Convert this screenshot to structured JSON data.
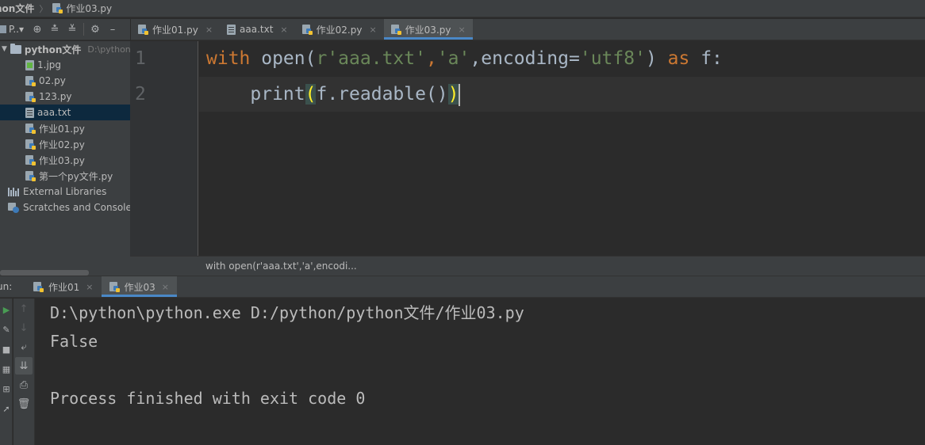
{
  "breadcrumb": {
    "project": "hon文件",
    "file": "作业03.py"
  },
  "project_panel": {
    "dropdown_label": "P..▾",
    "root": {
      "name": "python文件",
      "path": "D:\\python\\"
    },
    "files": [
      "1.jpg",
      "02.py",
      "123.py",
      "aaa.txt",
      "作业01.py",
      "作业02.py",
      "作业03.py",
      "第一个py文件.py"
    ],
    "selected_file": "aaa.txt",
    "external_libraries": "External Libraries",
    "scratches": "Scratches and Consoles"
  },
  "editor_tabs": [
    {
      "label": "作业01.py",
      "close": "×"
    },
    {
      "label": "aaa.txt",
      "close": "×"
    },
    {
      "label": "作业02.py",
      "close": "×"
    },
    {
      "label": "作业03.py",
      "close": "×"
    }
  ],
  "active_tab": "作业03.py",
  "editor": {
    "line_numbers": [
      "1",
      "2"
    ],
    "line1": {
      "kw_with": "with",
      "open": " open(",
      "s1": "r'aaa.txt'",
      "comma1": ",",
      "s2": "'a'",
      "enc": ",encoding=",
      "s3": "'utf8'",
      "close": ") ",
      "kw_as": "as",
      "f": " f:"
    },
    "line2": {
      "indent": "    print",
      "lparen": "(",
      "body": "f.readable()",
      "rparen": ")"
    }
  },
  "structure_breadcrumb": "with open(r'aaa.txt','a',encodi...",
  "run_panel": {
    "label": "un:",
    "tabs": [
      {
        "label": "作业01",
        "close": "×"
      },
      {
        "label": "作业03",
        "close": "×"
      }
    ],
    "active_tab": "作业03"
  },
  "console": {
    "lines": [
      "D:\\python\\python.exe D:/python/python文件/作业03.py",
      "False",
      "",
      "Process finished with exit code 0"
    ]
  },
  "colors": {
    "keyword": "#cc7832",
    "string": "#6a8759",
    "text": "#a9b7c6",
    "accent": "#4a88c7",
    "brace_match": "#ffef28"
  }
}
